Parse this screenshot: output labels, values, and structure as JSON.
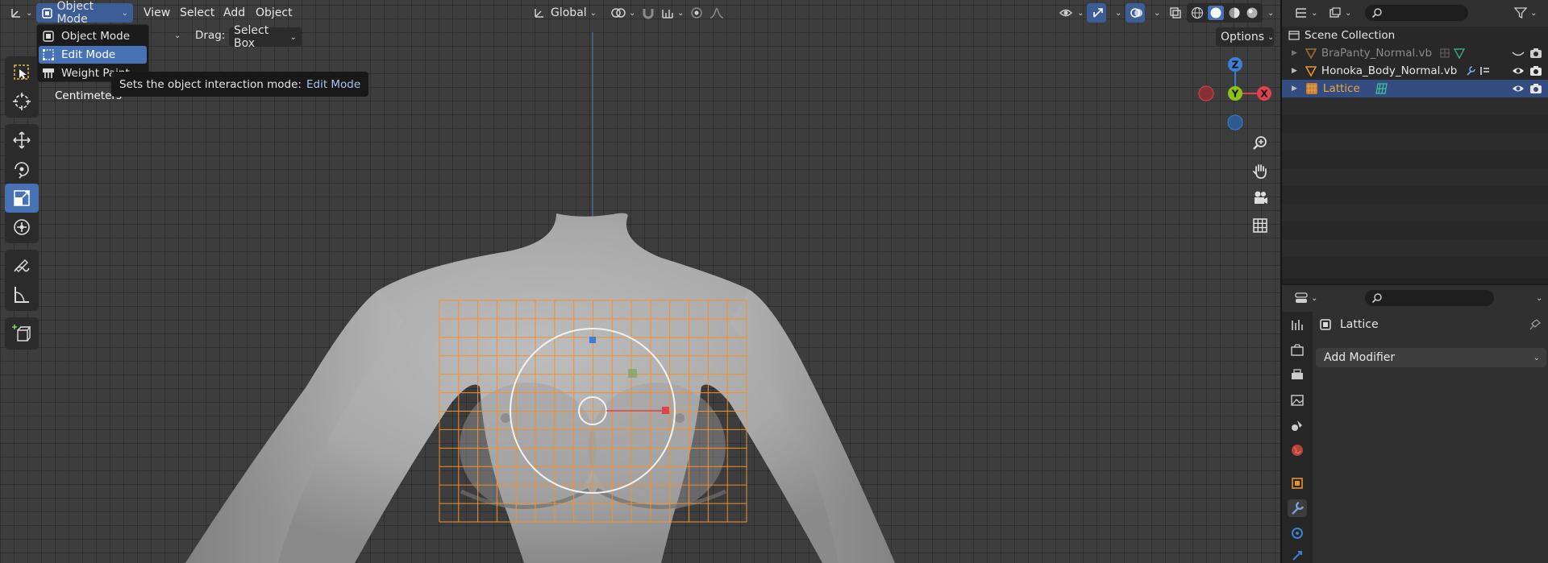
{
  "header": {
    "mode": "Object Mode",
    "menus": [
      "View",
      "Select",
      "Add",
      "Object"
    ],
    "transform_orientation": "Global"
  },
  "toolsettings": {
    "drag_label": "Drag:",
    "drag_value": "Select Box",
    "options_label": "Options",
    "partial_text": "t"
  },
  "mode_dropdown": {
    "items": [
      "Object Mode",
      "Edit Mode",
      "Weight Paint"
    ],
    "selected": "Edit Mode"
  },
  "tooltip": {
    "text": "Sets the object interaction mode:",
    "value": "Edit Mode"
  },
  "viewport": {
    "units_label": "Centimeters",
    "gizmo": {
      "z": "Z",
      "y": "Y",
      "x": "X"
    }
  },
  "outliner": {
    "title": "Scene Collection",
    "rows": [
      {
        "name": "BraPanty_Normal.vb",
        "hidden": true
      },
      {
        "name": "Honoka_Body_Normal.vb",
        "hidden": false
      },
      {
        "name": "Lattice",
        "hidden": false,
        "selected": true
      }
    ]
  },
  "properties": {
    "object_name": "Lattice",
    "add_modifier_label": "Add Modifier"
  },
  "colors": {
    "accent": "#4772b3",
    "lattice": "#f0922e",
    "gizmo_x": "#e0414f",
    "gizmo_y": "#8cc215",
    "gizmo_z": "#3b7fd6",
    "selected_name": "#f2a23a"
  }
}
